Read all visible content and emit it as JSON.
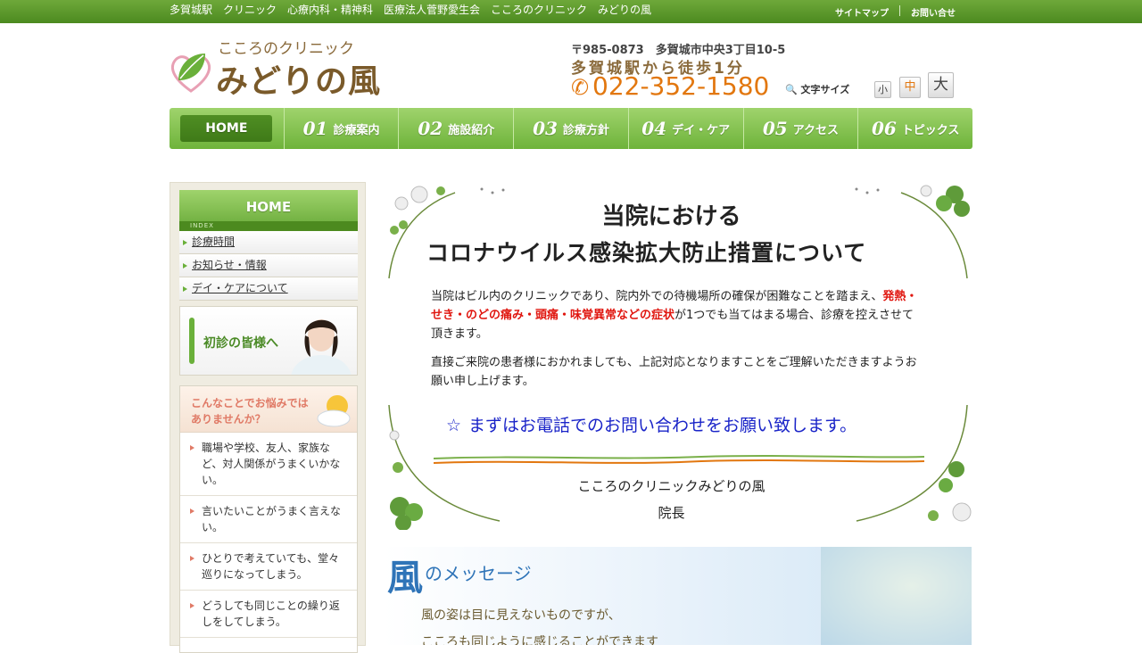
{
  "topbar": {
    "tagline": "多賀城駅　クリニック　心療内科・精神科　医療法人菅野愛生会　こころのクリニック　みどりの風",
    "sitemap": "サイトマップ",
    "contact": "お問い合せ"
  },
  "logo": {
    "sub": "こころのクリニック",
    "main": "みどりの風"
  },
  "contact_info": {
    "address": "〒985-0873　多賀城市中央3丁目10-5",
    "access": "多賀城駅から徒歩1分",
    "phone": "022-352-1580",
    "phone_icon": "phone-icon"
  },
  "font_size": {
    "label": "文字サイズ",
    "small": "小",
    "medium": "中",
    "large": "大"
  },
  "nav": [
    {
      "num": "",
      "label": "HOME"
    },
    {
      "num": "01",
      "label": "診療案内"
    },
    {
      "num": "02",
      "label": "施設紹介"
    },
    {
      "num": "03",
      "label": "診療方針"
    },
    {
      "num": "04",
      "label": "デイ・ケア"
    },
    {
      "num": "05",
      "label": "アクセス"
    },
    {
      "num": "06",
      "label": "トピックス"
    }
  ],
  "sidebar": {
    "home": "HOME",
    "index": "INDEX",
    "links": [
      "診療時間",
      "お知らせ・情報",
      "デイ・ケアについて"
    ],
    "first_visit": "初診の皆様へ",
    "worry_title1": "こんなことでお悩みでは",
    "worry_title2": "ありませんか？",
    "worries": [
      "職場や学校、友人、家族など、対人関係がうまくいかない。",
      "言いたいことがうまく言えない。",
      "ひとりで考えていても、堂々巡りになってしまう。",
      "どうしても同じことの繰り返しをしてしまう。"
    ]
  },
  "notice": {
    "title1": "当院における",
    "title2": "コロナウイルス感染拡大防止措置について",
    "p1_a": "当院はビル内のクリニックであり、院内外での待機場所の確保が困難なことを踏まえ、",
    "p1_red": "発熱・せき・のどの痛み・頭痛・味覚異常などの症状",
    "p1_b": "が1つでも当てはまる場合、診療を控えさせて頂きます。",
    "p2": "直接ご来院の患者様におかれましても、上記対応となりますことをご理解いただきますようお願い申し上げます。",
    "call_star": "☆",
    "call": "まずはお電話でのお問い合わせをお願い致します。",
    "signature1": "こころのクリニックみどりの風",
    "signature2": "院長"
  },
  "message": {
    "kaze": "風",
    "title": "のメッセージ",
    "line1": "風の姿は目に見えないものですが、",
    "line2": "こころも同じように感じることができます"
  },
  "colors": {
    "green": "#6ab03a",
    "dark_green": "#4c8a1f",
    "orange": "#e2770f",
    "red": "#e0160f",
    "blue": "#1a24c8",
    "brown": "#7a5a2a"
  }
}
